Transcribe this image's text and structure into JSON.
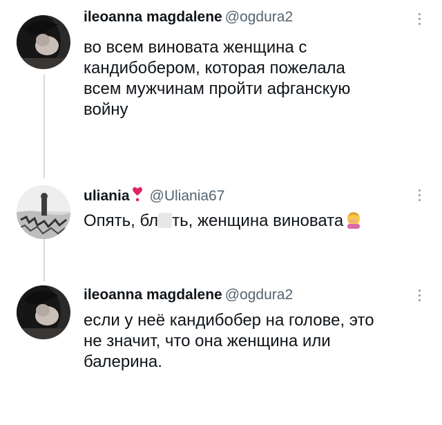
{
  "tweets": [
    {
      "author_name": "ileoanna magdalene",
      "author_handle": "@ogdura2",
      "text": "во всем виновата женщина с\nкандибобером, которая пожелала\nвсем мужчинам пройти афганскую\nвойну",
      "avatar_icon": "profile-photo",
      "more_icon": "more-vertical-icon"
    },
    {
      "author_name": "uliania",
      "author_handle": "@Uliania67",
      "name_emoji": "heart-exclamation-icon",
      "text_before_censor": "Опять, бл",
      "text_after_censor": "ть, женщина виновата",
      "text_emoji": "facepalm-woman-icon",
      "avatar_icon": "profile-photo",
      "more_icon": "more-vertical-icon"
    },
    {
      "author_name": "ileoanna magdalene",
      "author_handle": "@ogdura2",
      "text": "если у неё кандибобер на голове, это\nне значит, что она женщина или\nбалерина.",
      "avatar_icon": "profile-photo",
      "more_icon": "more-vertical-icon"
    }
  ],
  "colors": {
    "text": "#0f1419",
    "secondary": "#536471",
    "thread_line": "#cfd9de",
    "heart": "#e0245e"
  }
}
